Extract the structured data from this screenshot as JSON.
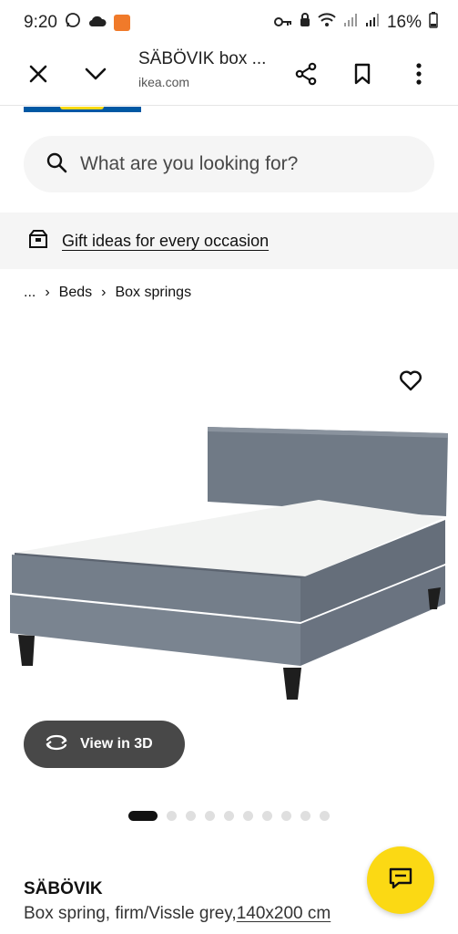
{
  "status_bar": {
    "time": "9:20",
    "battery": "16%"
  },
  "tab": {
    "title": "SÄBÖVIK box ...",
    "url": "ikea.com"
  },
  "search": {
    "placeholder": "What are you looking for?"
  },
  "gift_banner": {
    "text": "Gift ideas for every occasion"
  },
  "breadcrumb": {
    "items": [
      "...",
      "Beds",
      "Box springs"
    ]
  },
  "product": {
    "name": "SÄBÖVIK",
    "description": "Box spring, firm/Vissle grey,",
    "size": "140x200 cm",
    "image_count": 10,
    "active_image": 1
  },
  "view3d": {
    "label": "View in 3D"
  },
  "colors": {
    "accent_yellow": "#fbd914",
    "ikea_blue": "#0058a3",
    "dark_button": "#484848",
    "banner_bg": "#f5f5f5"
  },
  "icons": [
    "close-icon",
    "chevron-down-icon",
    "share-icon",
    "bookmark-icon",
    "more-vert-icon",
    "search-icon",
    "gift-box-icon",
    "heart-icon",
    "rotate-3d-icon",
    "chat-icon"
  ]
}
